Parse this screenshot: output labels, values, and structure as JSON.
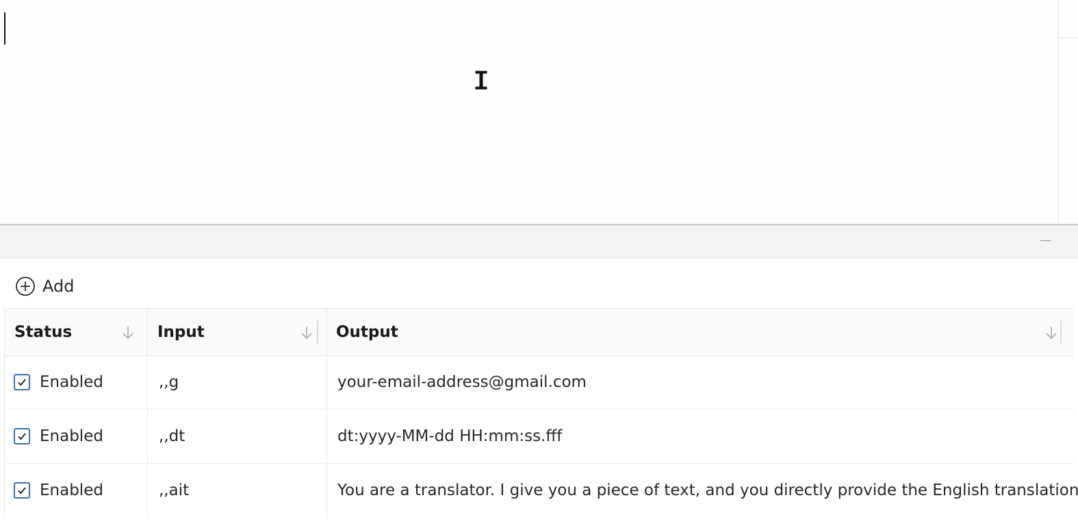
{
  "toolbar": {
    "add_label": "Add"
  },
  "table": {
    "columns": [
      {
        "label": "Status",
        "sort_icon": "arrow-down-icon"
      },
      {
        "label": "Input",
        "sort_icon": "arrow-down-icon"
      },
      {
        "label": "Output",
        "sort_icon": "arrow-down-icon"
      }
    ],
    "rows": [
      {
        "checked": true,
        "status": "Enabled",
        "input": ",,g",
        "output": "your-email-address@gmail.com"
      },
      {
        "checked": true,
        "status": "Enabled",
        "input": ",,dt",
        "output": "dt:yyyy-MM-dd HH:mm:ss.fff"
      },
      {
        "checked": true,
        "status": "Enabled",
        "input": ",,ait",
        "output": "You are a translator. I give you a piece of text, and you directly provide the English translation."
      }
    ]
  },
  "colors": {
    "checkbox_accent": "#3a6ea5",
    "panel_header_bg": "#f3f3f3",
    "table_header_bg": "#fafafa"
  }
}
